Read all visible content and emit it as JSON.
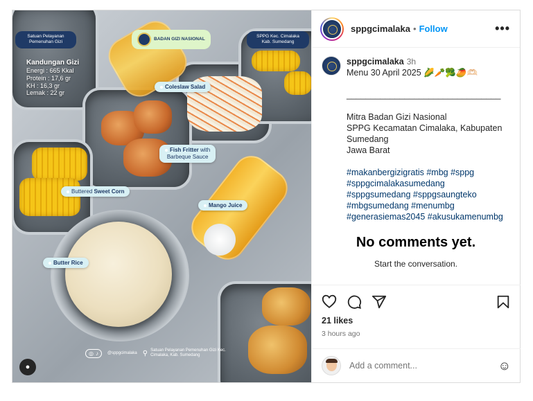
{
  "photo": {
    "badge_left": "Satuan Pelayanan Pemenuhan Gizi",
    "badge_center": "BADAN GIZI NASIONAL",
    "badge_right": "SPPG Kec. Cimalaka Kab. Sumedang",
    "nutrition": {
      "title": "Kandungan Gizi",
      "lines": [
        "Energi : 665 Kkal",
        "Protein : 17,6 gr",
        "KH : 16,3 gr",
        "Lemak : 22 gr"
      ]
    },
    "labels": {
      "coleslaw": "Coleslaw Salad",
      "fish_bold": "Fish Fritter",
      "fish_rest": " with",
      "fish_line2": "Barbeque Sauce",
      "corn_a": "Buttered ",
      "corn_b": "Sweet Corn",
      "juice": "Mango Juice",
      "rice": "Butter Rice"
    },
    "footer_handle": "@sppgcimalaka",
    "footer_location": "Satuan Pelayanan Pemenuhan Gizi Kec. Cimalaka, Kab. Sumedang",
    "social_icon_names": [
      "instagram-icon",
      "tiktok-icon"
    ],
    "tag_user_icon": "person-icon"
  },
  "header": {
    "username": "sppgcimalaka",
    "separator": "•",
    "follow_label": "Follow",
    "more_label": "•••"
  },
  "caption": {
    "username": "sppgcimalaka",
    "time": "3h",
    "title": "Menu 30 April 2025 🌽🥕🥦🥭🫶🏻",
    "divider": "________________________________",
    "org_lines": [
      "Mitra Badan Gizi Nasional",
      "SPPG Kecamatan Cimalaka, Kabupaten",
      "Sumedang",
      "Jawa Barat"
    ],
    "hashtag_lines": [
      "#makanbergizigratis #mbg #sppg",
      "#sppgcimalakasumedang",
      "#sppgsumedang #sppgsaungteko",
      "#mbgsumedang #menumbg",
      "#generasiemas2045 #akusukamenumbg"
    ]
  },
  "comments": {
    "empty_title": "No comments yet.",
    "empty_sub": "Start the conversation."
  },
  "actions": {
    "likes": "21 likes",
    "time_ago": "3 hours ago",
    "icons": [
      "heart-icon",
      "comment-icon",
      "share-icon",
      "bookmark-icon"
    ]
  },
  "add_comment": {
    "placeholder": "Add a comment...",
    "emoji_icon": "☺"
  },
  "colors": {
    "follow_blue": "#0095f6",
    "hashtag_blue": "#00376b",
    "badge_navy": "#1f3a66"
  }
}
